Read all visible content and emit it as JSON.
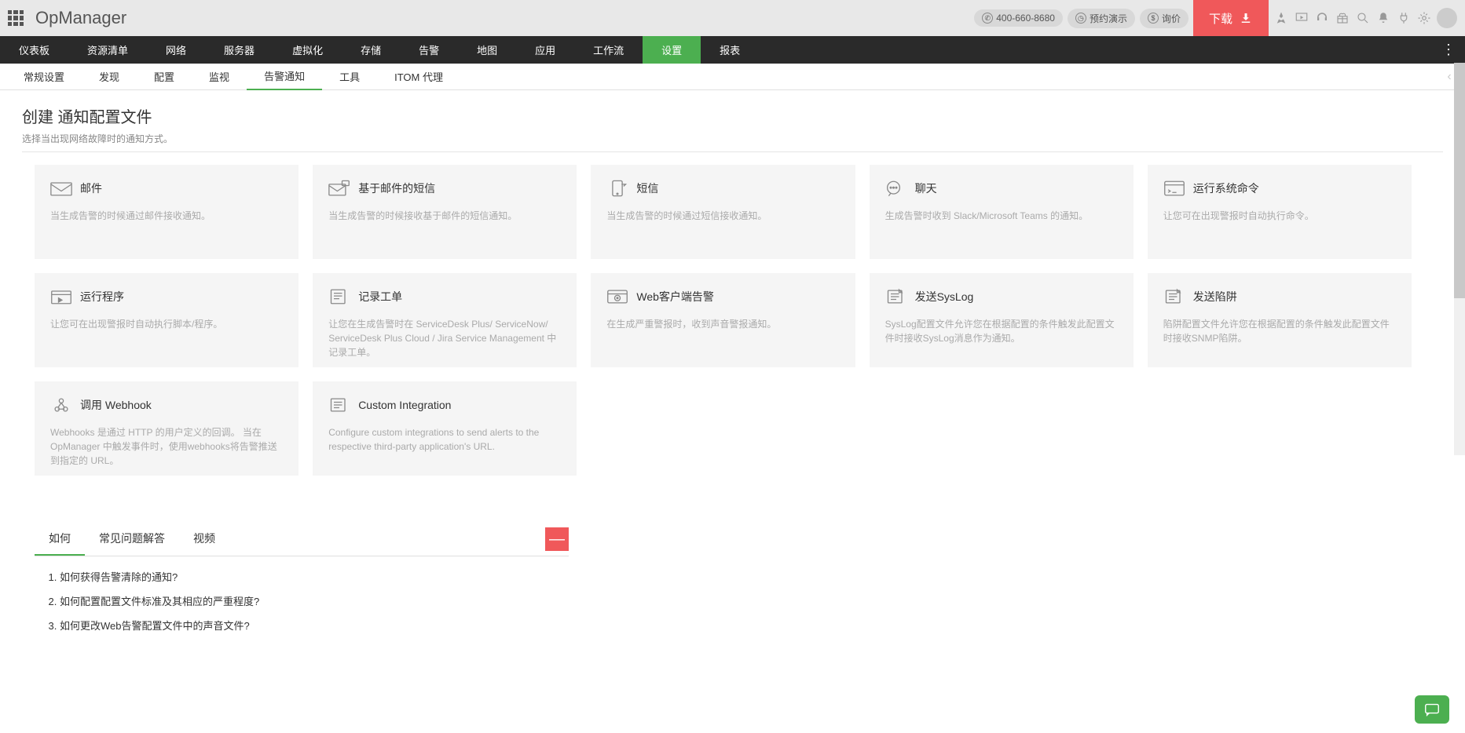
{
  "header": {
    "logo": "OpManager",
    "phone": "400-660-8680",
    "demo": "预约演示",
    "quote": "询价",
    "download": "下载"
  },
  "mainNav": [
    "仪表板",
    "资源清单",
    "网络",
    "服务器",
    "虚拟化",
    "存储",
    "告警",
    "地图",
    "应用",
    "工作流",
    "设置",
    "报表"
  ],
  "mainNavActive": 10,
  "subNav": [
    "常规设置",
    "发现",
    "配置",
    "监视",
    "告警通知",
    "工具",
    "ITOM 代理"
  ],
  "subNavActive": 4,
  "page": {
    "title": "创建 通知配置文件",
    "subtitle": "选择当出现网络故障时的通知方式。"
  },
  "cards": [
    {
      "title": "邮件",
      "desc": "当生成告警的时候通过邮件接收通知。",
      "icon": "mail"
    },
    {
      "title": "基于邮件的短信",
      "desc": "当生成告警的时候接收基于邮件的短信通知。",
      "icon": "mail-sms"
    },
    {
      "title": "短信",
      "desc": "当生成告警的时候通过短信接收通知。",
      "icon": "phone"
    },
    {
      "title": "聊天",
      "desc": "生成告警时收到 Slack/Microsoft Teams 的通知。",
      "icon": "chat"
    },
    {
      "title": "运行系统命令",
      "desc": "让您可在出现警报时自动执行命令。",
      "icon": "command"
    },
    {
      "title": "运行程序",
      "desc": "让您可在出现警报时自动执行脚本/程序。",
      "icon": "program"
    },
    {
      "title": "记录工单",
      "desc": "让您在生成告警时在 ServiceDesk Plus/ ServiceNow/ ServiceDesk Plus Cloud / Jira Service Management 中记录工单。",
      "icon": "ticket"
    },
    {
      "title": "Web客户端告警",
      "desc": "在生成严重警报时，收到声音警报通知。",
      "icon": "web-alert"
    },
    {
      "title": "发送SysLog",
      "desc": "SysLog配置文件允许您在根据配置的条件触发此配置文件时接收SysLog消息作为通知。",
      "icon": "syslog"
    },
    {
      "title": "发送陷阱",
      "desc": "陷阱配置文件允许您在根据配置的条件触发此配置文件时接收SNMP陷阱。",
      "icon": "trap"
    },
    {
      "title": "调用 Webhook",
      "desc": "Webhooks 是通过 HTTP 的用户定义的回调。 当在 OpManager 中触发事件时，使用webhooks将告警推送到指定的 URL。",
      "icon": "webhook"
    },
    {
      "title": "Custom Integration",
      "desc": "Configure custom integrations to send alerts to the respective third-party application's URL.",
      "icon": "custom"
    }
  ],
  "help": {
    "tabs": [
      "如何",
      "常见问题解答",
      "视频"
    ],
    "activeTab": 0,
    "items": [
      "如何获得告警清除的通知?",
      "如何配置配置文件标准及其相应的严重程度?",
      "如何更改Web告警配置文件中的声音文件?"
    ]
  }
}
